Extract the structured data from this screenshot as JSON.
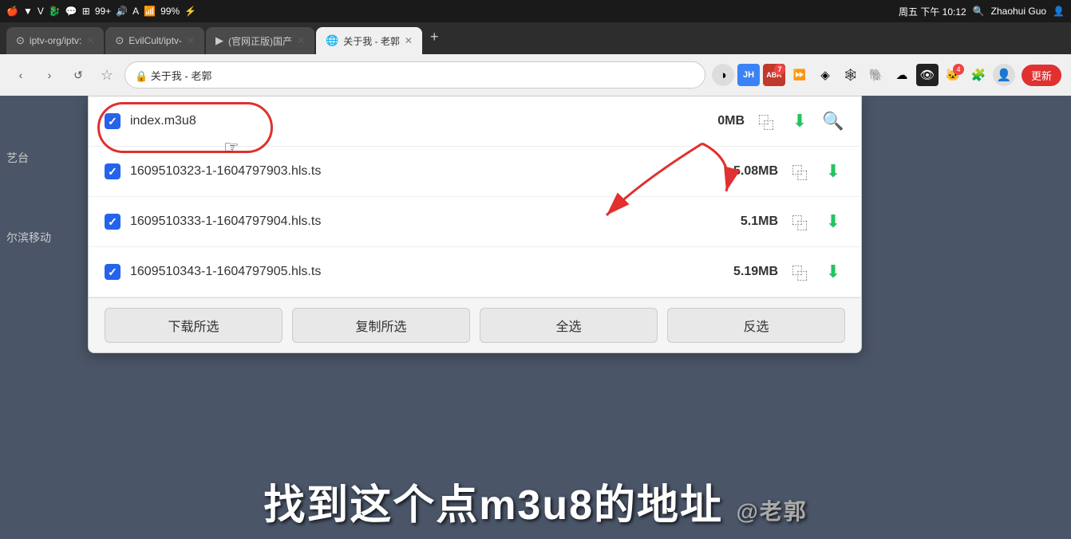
{
  "statusBar": {
    "leftIcons": [
      "▼",
      "V",
      "🐉",
      "💬",
      "⊞",
      "99+",
      "🔊",
      "A",
      "📶",
      "99%",
      "⚡"
    ],
    "time": "周五 下午 10:12",
    "rightItems": [
      "🔍",
      "Zhaohui Guo"
    ]
  },
  "tabs": [
    {
      "id": "tab1",
      "icon": "⊙",
      "label": "iptv-org/iptv:",
      "active": false
    },
    {
      "id": "tab2",
      "icon": "⊙",
      "label": "EvilCult/iptv-",
      "active": false
    },
    {
      "id": "tab3",
      "icon": "▶",
      "label": "(官网正版)国产",
      "active": false
    },
    {
      "id": "tab4",
      "icon": "🌐",
      "label": "关于我 - 老郭",
      "active": true
    }
  ],
  "toolbar": {
    "bookmarkLabel": "☆",
    "extensions": [
      {
        "id": "ext1",
        "icon": "◑",
        "badge": null
      },
      {
        "id": "ext2",
        "icon": "JH",
        "badge": null,
        "bg": "#3b82f6",
        "color": "#fff"
      },
      {
        "id": "ext3",
        "icon": "ABR",
        "badge": "7",
        "bg": "#e74c3c",
        "color": "#fff"
      },
      {
        "id": "ext4",
        "icon": "▶▶",
        "badge": null
      },
      {
        "id": "ext5",
        "icon": "◈",
        "badge": null
      },
      {
        "id": "ext6",
        "icon": "🕸",
        "badge": null
      },
      {
        "id": "ext7",
        "icon": "🐘",
        "badge": null
      },
      {
        "id": "ext8",
        "icon": "☁",
        "badge": null
      },
      {
        "id": "ext9",
        "icon": "👁",
        "badge": null
      },
      {
        "id": "ext10",
        "icon": "🐱",
        "badge": "4",
        "highlight": true
      },
      {
        "id": "ext11",
        "icon": "🧩",
        "badge": null
      },
      {
        "id": "ext12",
        "icon": "👤",
        "badge": null
      }
    ],
    "updateBtn": "更新"
  },
  "downloadPanel": {
    "items": [
      {
        "id": "item1",
        "checked": true,
        "name": "index.m3u8",
        "size": "0MB",
        "highlighted": true
      },
      {
        "id": "item2",
        "checked": true,
        "name": "1609510323-1-1604797903.hls.ts",
        "size": "5.08MB",
        "highlighted": false
      },
      {
        "id": "item3",
        "checked": true,
        "name": "1609510333-1-1604797904.hls.ts",
        "size": "5.1MB",
        "highlighted": false
      },
      {
        "id": "item4",
        "checked": true,
        "name": "1609510343-1-1604797905.hls.ts",
        "size": "5.19MB",
        "highlighted": false
      }
    ],
    "buttons": [
      "下载所选",
      "复制所选",
      "全选",
      "反选"
    ]
  },
  "subtitle": {
    "main": "找到这个点m3u8的地址",
    "attribution": "@老郭"
  },
  "sidebar": {
    "items": [
      "艺台",
      "尔滨移动"
    ]
  },
  "annotations": {
    "arrow": "→"
  }
}
